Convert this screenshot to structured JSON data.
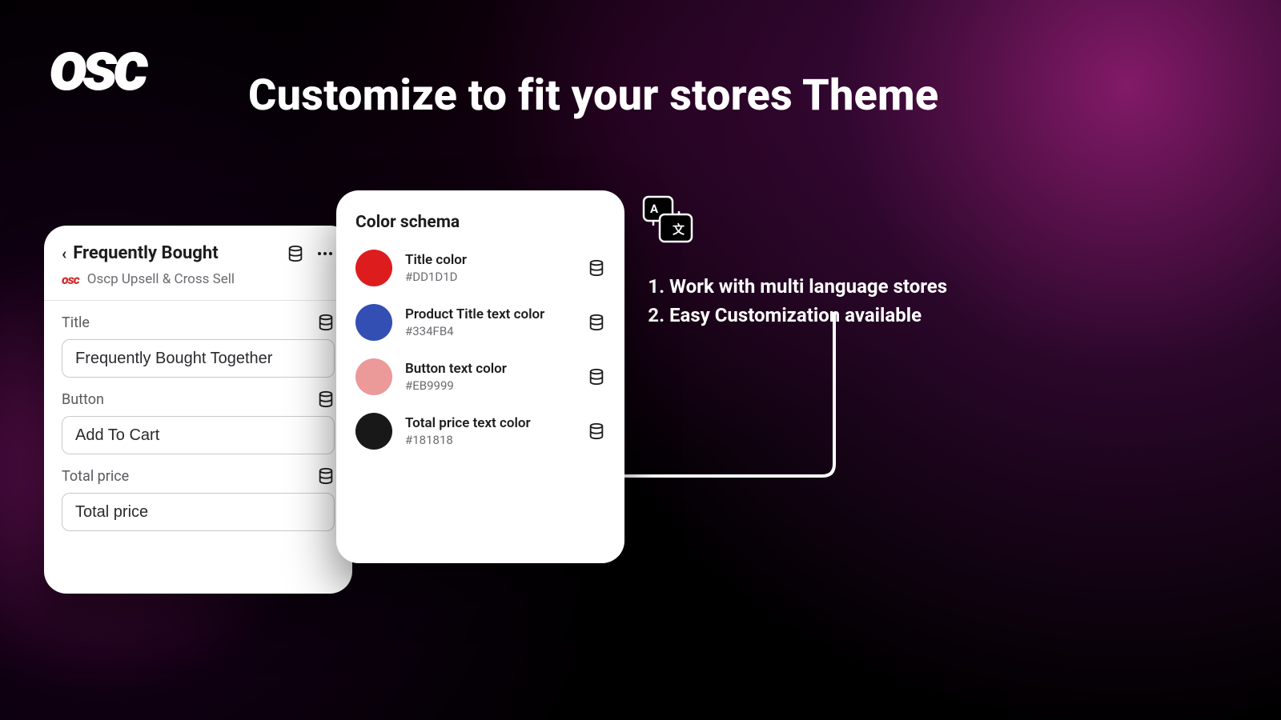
{
  "brand": "osc",
  "page_title": "Customize to fit your stores Theme",
  "bullets": [
    "Work with multi language stores",
    "Easy Customization available"
  ],
  "left_card": {
    "title": "Frequently Bought",
    "app_name": "Oscp Upsell & Cross Sell",
    "fields": {
      "title": {
        "label": "Title",
        "value": "Frequently Bought Together"
      },
      "button": {
        "label": "Button",
        "value": "Add To Cart"
      },
      "total_price": {
        "label": "Total price",
        "value": "Total price"
      }
    }
  },
  "right_card": {
    "title": "Color schema",
    "colors": [
      {
        "label": "Title color",
        "hex": "#DD1D1D"
      },
      {
        "label": "Product Title text color",
        "hex": "#334FB4"
      },
      {
        "label": "Button text color",
        "hex": "#EB9999"
      },
      {
        "label": "Total price text color",
        "hex": "#181818"
      }
    ]
  }
}
